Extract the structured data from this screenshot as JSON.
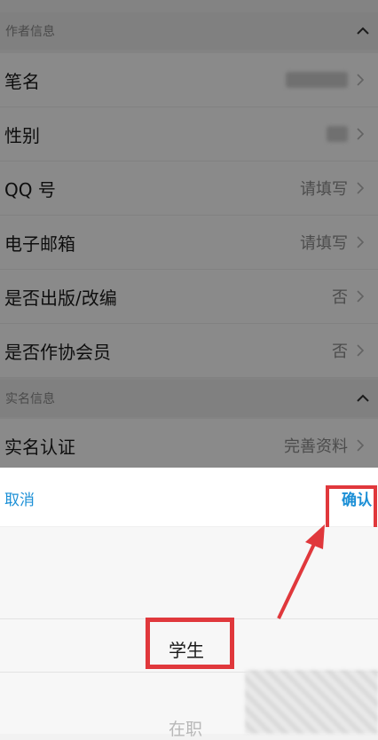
{
  "sections": {
    "author_info": "作者信息",
    "realname_info": "实名信息"
  },
  "rows": {
    "pen_name": {
      "label": "笔名"
    },
    "gender": {
      "label": "性别"
    },
    "qq": {
      "label": "QQ 号",
      "value": "请填写"
    },
    "email": {
      "label": "电子邮箱",
      "value": "请填写"
    },
    "published": {
      "label": "是否出版/改编",
      "value": "否"
    },
    "association": {
      "label": "是否作协会员",
      "value": "否"
    },
    "realname": {
      "label": "实名认证",
      "value": "完善资料"
    }
  },
  "picker": {
    "cancel_label": "取消",
    "confirm_label": "确认",
    "options": [
      "学生",
      "在职"
    ],
    "selected": "学生"
  },
  "colors": {
    "accent": "#1b8fd6",
    "highlight": "#e0383c"
  },
  "icons": {
    "collapse": "chevron-up-icon",
    "row_arrow": "chevron-right-icon",
    "annotation": "arrow-up-right-icon"
  }
}
